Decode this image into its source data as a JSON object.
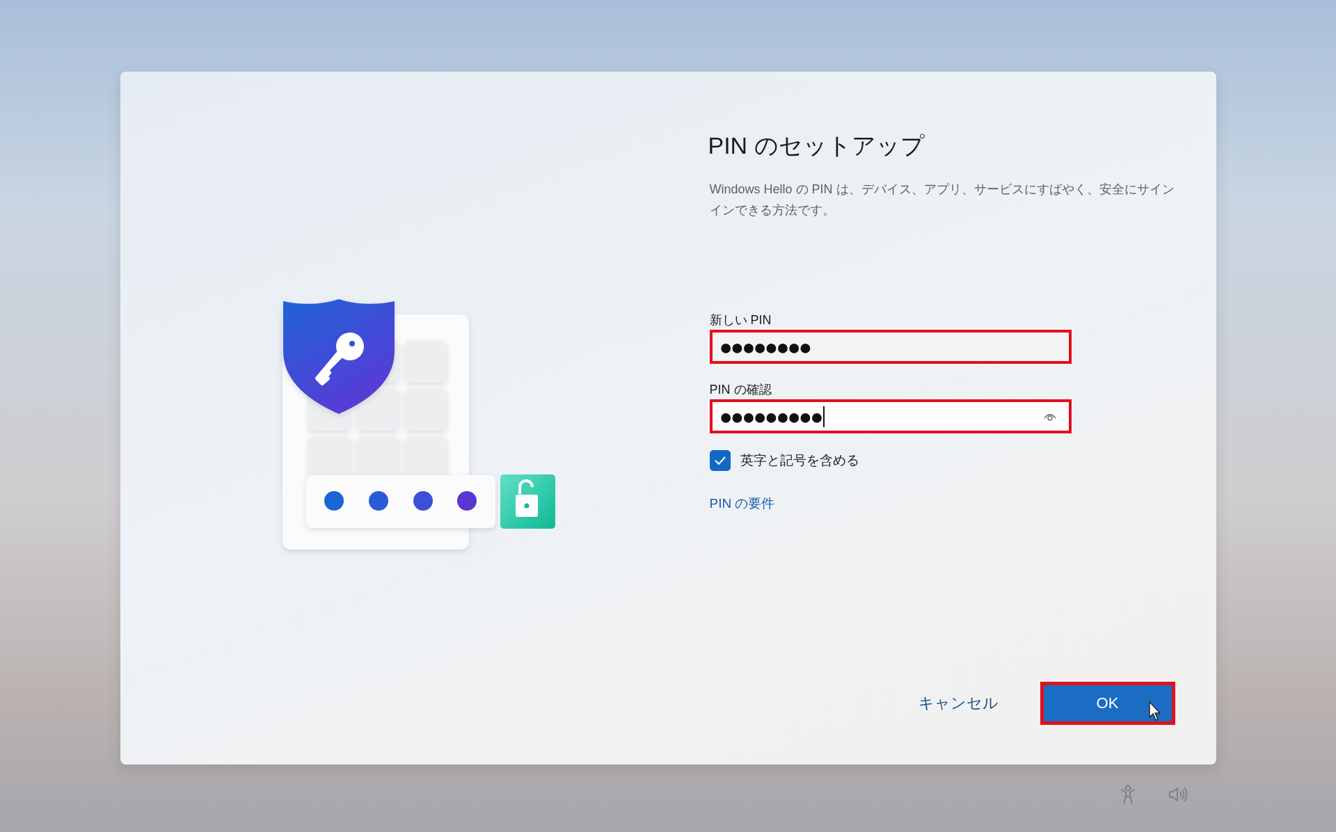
{
  "title": "PIN のセットアップ",
  "description": "Windows Hello の PIN は、デバイス、アプリ、サービスにすばやく、安全にサインインできる方法です。",
  "fields": [
    {
      "label": "新しい PIN",
      "value": "●●●●●●●●",
      "focused": false,
      "highlighted": true,
      "reveal_button": false
    },
    {
      "label": "PIN の確認",
      "value": "●●●●●●●●●",
      "focused": true,
      "highlighted": true,
      "reveal_button": true
    }
  ],
  "checkbox": {
    "label": "英字と記号を含める",
    "checked": true
  },
  "link": "PIN の要件",
  "buttons": [
    {
      "label": "キャンセル",
      "kind": "text",
      "highlighted": false
    },
    {
      "label": "OK",
      "kind": "primary",
      "highlighted": true
    }
  ]
}
